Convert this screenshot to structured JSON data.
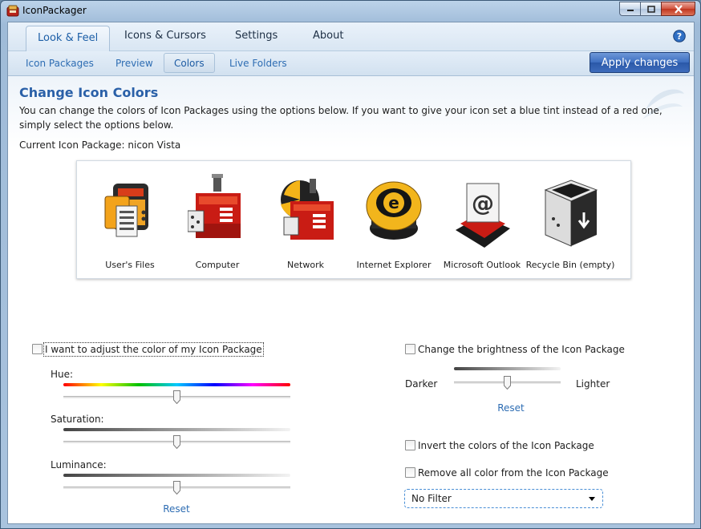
{
  "window": {
    "title": "IconPackager"
  },
  "tabs": [
    "Look & Feel",
    "Icons & Cursors",
    "Settings",
    "About"
  ],
  "subtabs": [
    "Icon Packages",
    "Preview",
    "Colors",
    "Live Folders"
  ],
  "apply_label": "Apply changes",
  "page": {
    "title": "Change Icon Colors",
    "description": "You can change the colors of Icon Packages using the options below. If you want to give your icon set a blue tint instead of a red one, simply select the options below.",
    "current_package": "Current Icon Package: nicon Vista"
  },
  "preview_icons": [
    {
      "label": "User's Files",
      "icon": "users-files-icon"
    },
    {
      "label": "Computer",
      "icon": "computer-icon"
    },
    {
      "label": "Network",
      "icon": "network-icon"
    },
    {
      "label": "Internet Explorer",
      "icon": "internet-explorer-icon"
    },
    {
      "label": "Microsoft Outlook",
      "icon": "microsoft-outlook-icon"
    },
    {
      "label": "Recycle Bin (empty)",
      "icon": "recycle-bin-icon"
    }
  ],
  "color_adjust": {
    "checkbox_label": "I want to adjust the color of my Icon Package",
    "checked": false,
    "hue_label": "Hue:",
    "saturation_label": "Saturation:",
    "luminance_label": "Luminance:",
    "hue_value": 0.5,
    "saturation_value": 0.5,
    "luminance_value": 0.5,
    "reset_label": "Reset"
  },
  "brightness": {
    "checkbox_label": "Change the brightness of the Icon Package",
    "checked": false,
    "darker_label": "Darker",
    "lighter_label": "Lighter",
    "value": 0.5,
    "reset_label": "Reset"
  },
  "invert": {
    "label": "Invert the colors of the Icon Package",
    "checked": false
  },
  "remove_color": {
    "label": "Remove all color from the Icon Package",
    "checked": false
  },
  "filter": {
    "selected": "No Filter"
  },
  "colors": {
    "accent": "#2a60a8",
    "link": "#2e6db3",
    "apply_button": "#2a58a8"
  }
}
